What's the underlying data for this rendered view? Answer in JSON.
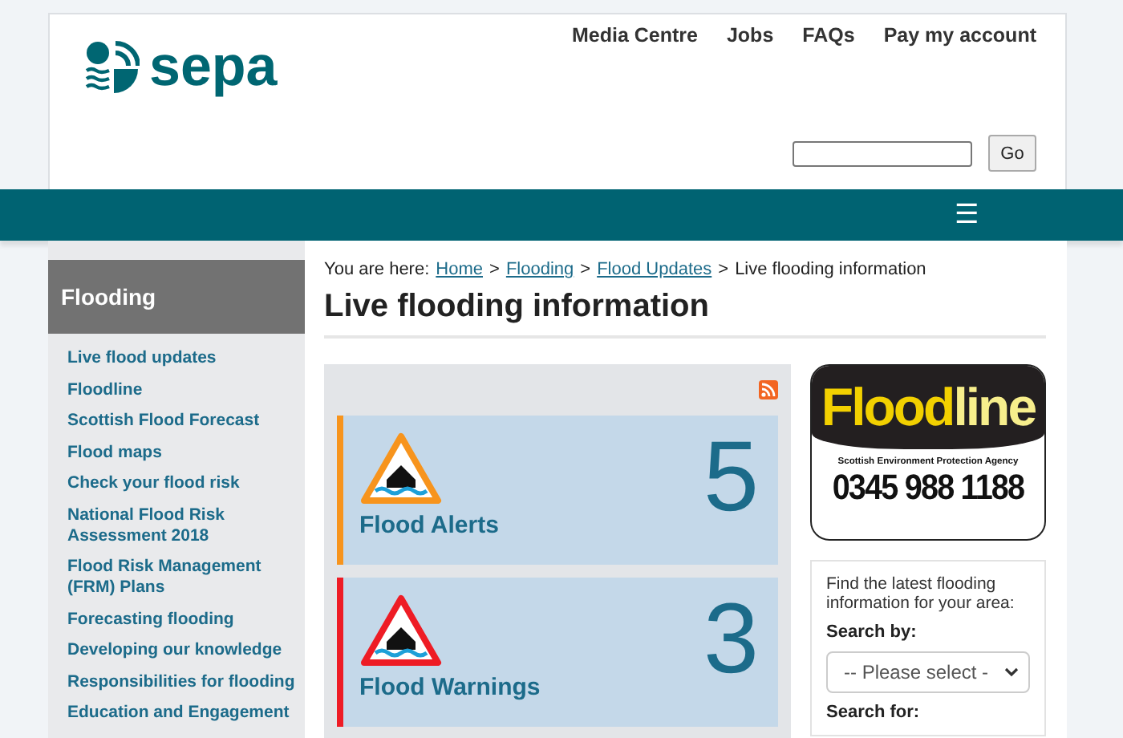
{
  "header": {
    "logo_text": "sepa",
    "top_links": [
      "Media Centre",
      "Jobs",
      "FAQs",
      "Pay my account"
    ],
    "search": {
      "button": "Go"
    },
    "menu_glyph": "☰"
  },
  "sidebar": {
    "title": "Flooding",
    "items": [
      "Live flood updates",
      "Floodline",
      "Scottish Flood Forecast",
      "Flood maps",
      "Check your flood risk",
      "National Flood Risk Assessment 2018",
      "Flood Risk Management (FRM) Plans",
      "Forecasting flooding",
      "Developing our knowledge",
      "Responsibilities for flooding",
      "Education and Engagement"
    ]
  },
  "breadcrumb": {
    "prefix": "You are here:",
    "links": [
      "Home",
      "Flooding",
      "Flood Updates"
    ],
    "separator": ">",
    "current": "Live flooding information"
  },
  "page_title": "Live flooding information",
  "flood_cards": [
    {
      "kind": "alert",
      "label": "Flood Alerts",
      "count": "5",
      "color": "#f7941d"
    },
    {
      "kind": "warning",
      "label": "Flood Warnings",
      "count": "3",
      "color": "#ee1c25"
    }
  ],
  "floodline": {
    "word_a": "Flood",
    "word_b": "line",
    "agency": "Scottish Environment Protection Agency",
    "phone": "0345 988 1188"
  },
  "area_search": {
    "intro": "Find the latest flooding information for your area:",
    "search_by_label": "Search by:",
    "select_value": "-- Please select -",
    "search_for_label": "Search for:"
  }
}
